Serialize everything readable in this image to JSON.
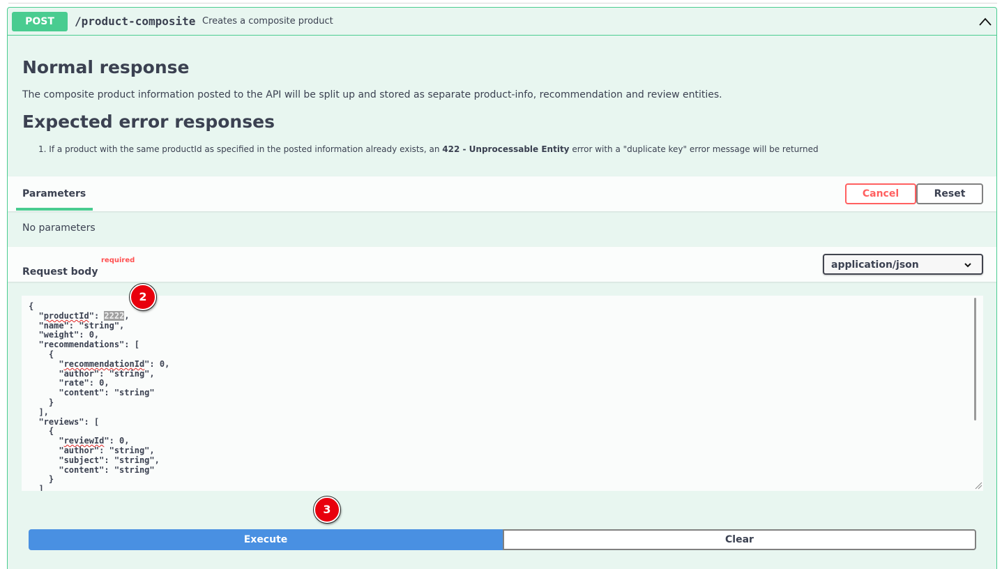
{
  "operation": {
    "method": "POST",
    "path": "/product-composite",
    "summary": "Creates a composite product",
    "colors": {
      "post_accent": "#49cc90",
      "post_background": "#e8f6f0"
    }
  },
  "description": {
    "normal_heading": "Normal response",
    "normal_text": "The composite product information posted to the API will be split up and stored as separate product-info, recommendation and review entities.",
    "error_heading": "Expected error responses",
    "error_item": {
      "number": "1.",
      "before": "If a product with the same productId as specified in the posted information already exists, an ",
      "bold": "422 - Unprocessable Entity",
      "after": " error with a \"duplicate key\" error message will be returned"
    }
  },
  "parameters": {
    "tab_label": "Parameters",
    "cancel_label": "Cancel",
    "reset_label": "Reset",
    "empty_text": "No parameters"
  },
  "request_body": {
    "title": "Request body",
    "required_label": "required",
    "content_type": "application/json",
    "editor_lines": [
      "{",
      "  \"productId\": 2222,",
      "  \"name\": \"string\",",
      "  \"weight\": 0,",
      "  \"recommendations\": [",
      "    {",
      "      \"recommendationId\": 0,",
      "      \"author\": \"string\",",
      "      \"rate\": 0,",
      "      \"content\": \"string\"",
      "    }",
      "  ],",
      "  \"reviews\": [",
      "    {",
      "      \"reviewId\": 0,",
      "      \"author\": \"string\",",
      "      \"subject\": \"string\",",
      "      \"content\": \"string\"",
      "    }",
      "  ]",
      "}"
    ],
    "selected_value": "2222",
    "spell_flagged": [
      "productId",
      "recommendationId",
      "reviewId"
    ]
  },
  "actions": {
    "execute_label": "Execute",
    "clear_label": "Clear"
  },
  "markers": [
    "2",
    "3"
  ],
  "icons": {
    "collapse": "chevron-up-icon",
    "select": "chevron-down-icon",
    "resize": "resize-handle-icon"
  }
}
